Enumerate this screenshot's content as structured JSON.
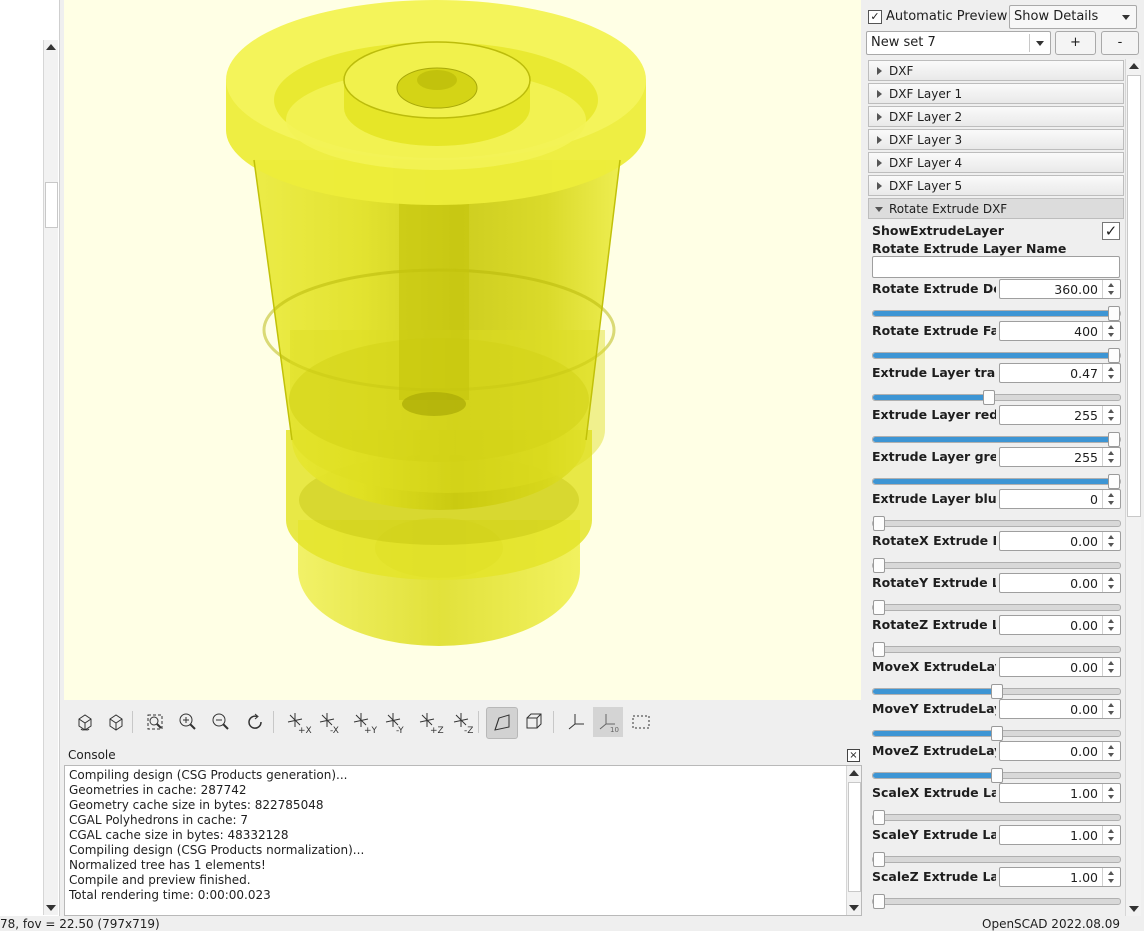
{
  "console": {
    "title": "Console",
    "close_icon": "close-icon",
    "lines": [
      "Compiling design (CSG Products generation)...",
      "Geometries in cache: 287742",
      "Geometry cache size in bytes: 822785048",
      "CGAL Polyhedrons in cache: 7",
      "CGAL cache size in bytes: 48332128",
      "Compiling design (CSG Products normalization)...",
      "Normalized tree has 1 elements!",
      "Compile and preview finished.",
      "Total rendering time: 0:00:00.023"
    ]
  },
  "status": {
    "left": "78, fov = 22.50 (797x719)",
    "right": "OpenSCAD 2022.08.09"
  },
  "customizer": {
    "auto_preview_label": "Automatic Preview",
    "auto_preview_checked": true,
    "details_select": "Show Details",
    "preset_select": "New set 7",
    "plus_label": "+",
    "minus_label": "-",
    "groups": [
      {
        "label": "DXF",
        "open": false
      },
      {
        "label": "DXF Layer 1",
        "open": false
      },
      {
        "label": "DXF Layer 2",
        "open": false
      },
      {
        "label": "DXF Layer 3",
        "open": false
      },
      {
        "label": "DXF Layer 4",
        "open": false
      },
      {
        "label": "DXF Layer 5",
        "open": false
      },
      {
        "label": "Rotate Extrude DXF",
        "open": true
      }
    ],
    "show_extrude_label": "ShowExtrudeLayer",
    "show_extrude_checked": true,
    "layer_name_label": "Rotate Extrude Layer Name",
    "layer_name_value": "",
    "params": [
      {
        "label": "Rotate Extrude De",
        "value": "360.00",
        "fraction": 1.0
      },
      {
        "label": "Rotate Extrude Fa",
        "value": "400",
        "fraction": 1.0
      },
      {
        "label": "Extrude Layer trar",
        "value": "0.47",
        "fraction": 0.47
      },
      {
        "label": "Extrude Layer red",
        "value": "255",
        "fraction": 1.0
      },
      {
        "label": "Extrude Layer gre",
        "value": "255",
        "fraction": 1.0
      },
      {
        "label": "Extrude Layer blue",
        "value": "0",
        "fraction": 0.0
      },
      {
        "label": "RotateX Extrude L",
        "value": "0.00",
        "fraction": 0.0
      },
      {
        "label": "RotateY Extrude L",
        "value": "0.00",
        "fraction": 0.0
      },
      {
        "label": "RotateZ Extrude L",
        "value": "0.00",
        "fraction": 0.0
      },
      {
        "label": "MoveX ExtrudeLay",
        "value": "0.00",
        "fraction": 0.5
      },
      {
        "label": "MoveY ExtrudeLay",
        "value": "0.00",
        "fraction": 0.5
      },
      {
        "label": "MoveZ ExtrudeLay",
        "value": "0.00",
        "fraction": 0.5
      },
      {
        "label": "ScaleX Extrude La",
        "value": "1.00",
        "fraction": 0.0
      },
      {
        "label": "ScaleY Extrude La",
        "value": "1.00",
        "fraction": 0.0
      },
      {
        "label": "ScaleZ Extrude La",
        "value": "1.00",
        "fraction": 0.0
      }
    ]
  },
  "toolbar": {
    "tools": [
      {
        "icon": "preview-icon",
        "axis": ""
      },
      {
        "icon": "render-icon",
        "axis": ""
      },
      {
        "icon": "view-all-icon",
        "axis": ""
      },
      {
        "icon": "zoom-in-icon",
        "axis": ""
      },
      {
        "icon": "zoom-out-icon",
        "axis": ""
      },
      {
        "icon": "reset-view-icon",
        "axis": ""
      },
      {
        "icon": "view-right-icon",
        "axis": "+X"
      },
      {
        "icon": "view-left-icon",
        "axis": "-X"
      },
      {
        "icon": "view-back-icon",
        "axis": "+Y"
      },
      {
        "icon": "view-front-icon",
        "axis": "-Y"
      },
      {
        "icon": "view-top-icon",
        "axis": "+Z"
      },
      {
        "icon": "view-bottom-icon",
        "axis": "-Z"
      },
      {
        "icon": "perspective-icon",
        "axis": ""
      },
      {
        "icon": "orthogonal-icon",
        "axis": ""
      },
      {
        "icon": "show-axes-icon",
        "axis": ""
      },
      {
        "icon": "show-scale-markers-icon",
        "axis": ""
      },
      {
        "icon": "show-edges-icon",
        "axis": ""
      }
    ]
  },
  "colors": {
    "viewport_bg": "#ffffe5",
    "model_fill": "#e6e600",
    "slider_fill": "#3d95d4"
  }
}
